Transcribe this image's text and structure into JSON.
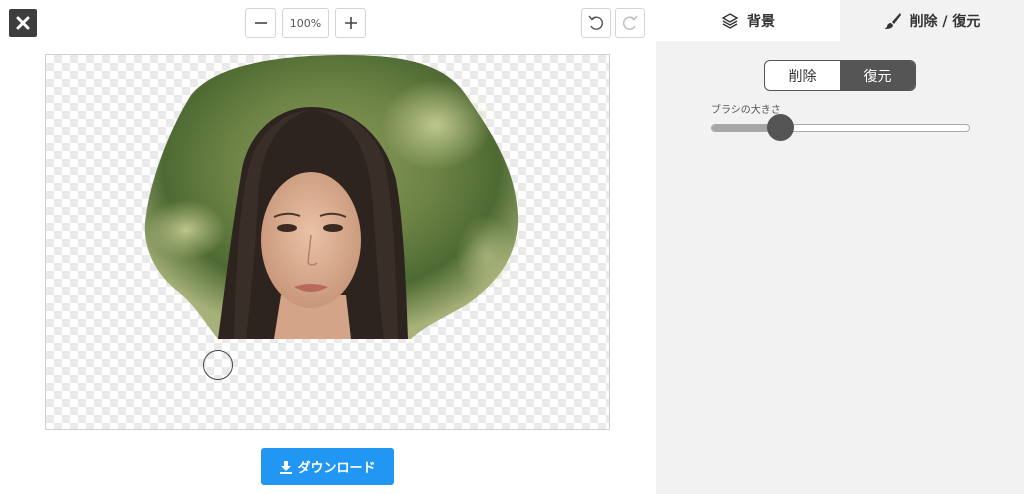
{
  "toolbar": {
    "close_icon": "close-icon",
    "zoom_out_icon": "minus-icon",
    "zoom_level": "100%",
    "zoom_in_icon": "plus-icon",
    "undo_icon": "undo-icon",
    "redo_icon": "redo-icon"
  },
  "download": {
    "label": "ダウンロード",
    "icon": "download-icon"
  },
  "panel": {
    "tabs": [
      {
        "label": "背景",
        "icon": "layers-icon",
        "active": false
      },
      {
        "label": "削除 / 復元",
        "icon": "brush-icon",
        "active": true
      }
    ],
    "mode": {
      "options": [
        "削除",
        "復元"
      ],
      "selected": "復元"
    },
    "brush_size": {
      "label": "ブラシの大きさ",
      "value_fraction": 0.27
    }
  },
  "colors": {
    "accent": "#2196f3",
    "dark": "#555555",
    "panel_bg": "#f2f2f2"
  }
}
